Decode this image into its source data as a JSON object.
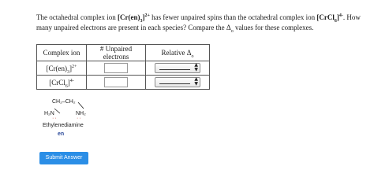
{
  "question": {
    "p1": "The octahedral complex ion ",
    "ion1_main": "[Cr(en)",
    "ion1_sub": "3",
    "ion1_close": "]",
    "ion1_sup": "2+",
    "p2": " has fewer unpaired spins than the octahedral complex ion ",
    "ion2_main": "[CrCl",
    "ion2_sub": "6",
    "ion2_close": "]",
    "ion2_sup": "4-",
    "p3": ". How many unpaired electrons are present in each species? Compare the Δ",
    "delta_sub": "o",
    "p4": " values for these complexes."
  },
  "table": {
    "headers": {
      "complex_ion": "Complex ion",
      "unpaired": "# Unpaired electrons",
      "relative_main": "Relative Δ",
      "relative_sub": "o"
    },
    "rows": [
      {
        "main": "[Cr(en)",
        "sub": "3",
        "close": "]",
        "sup": "2+",
        "unpaired_value": "",
        "relative_value": ""
      },
      {
        "main": "[CrCl",
        "sub": "6",
        "close": "]",
        "sup": "4-",
        "unpaired_value": "",
        "relative_value": ""
      }
    ]
  },
  "diagram": {
    "top": "CH₂–CH₂",
    "left": "H₂N",
    "right": "NH₂",
    "lone_pair": "··",
    "caption": "Ethylenediamine",
    "abbrev": "en",
    "abbrev_color": "#2b4a9a",
    "lone_pair_color": "#c0392b"
  },
  "submit_label": "Submit Answer",
  "accent_color": "#2b8ee6"
}
